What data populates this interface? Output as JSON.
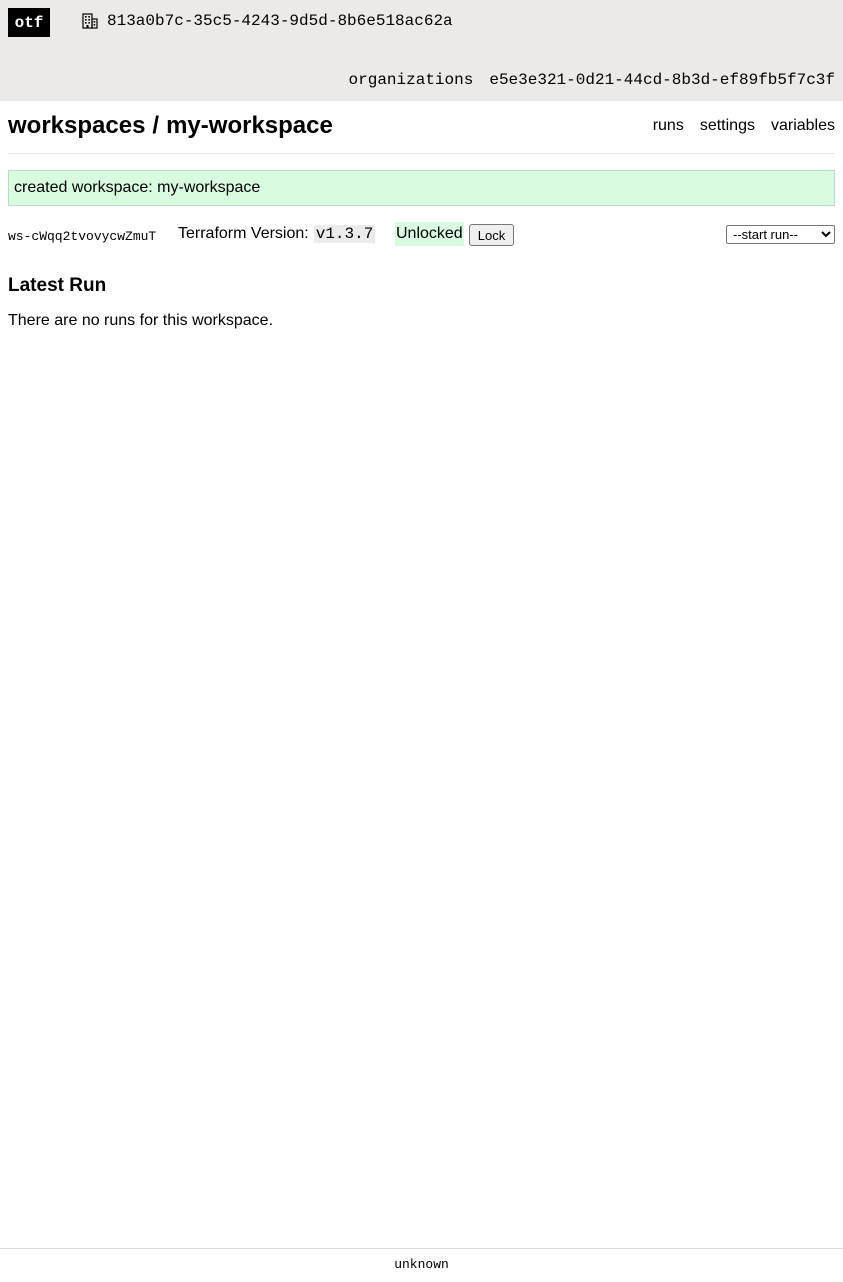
{
  "header": {
    "logo": "otf",
    "current_organization": {
      "icon": "building-icon",
      "name": "813a0b7c-35c5-4243-9d5d-8b6e518ac62a"
    },
    "nav": {
      "organizations_label": "organizations",
      "organization_link": "e5e3e321-0d21-44cd-8b3d-ef89fb5f7c3f"
    }
  },
  "page": {
    "breadcrumb": {
      "parent": "workspaces",
      "separator": "/",
      "current": "my-workspace"
    },
    "tabs": [
      {
        "label": "runs"
      },
      {
        "label": "settings"
      },
      {
        "label": "variables"
      }
    ]
  },
  "flash": {
    "message": "created workspace: my-workspace",
    "color": "#d9fbe0"
  },
  "workspace": {
    "id": "ws-cWqq2tvovycwZmuT",
    "terraform_version_label": "Terraform Version:",
    "terraform_version": "v1.3.7",
    "lock_status": "Unlocked",
    "lock_button_label": "Lock",
    "start_run_selected": "--start run--"
  },
  "latest_run": {
    "heading": "Latest Run",
    "empty_message": "There are no runs for this workspace."
  },
  "footer": {
    "version": "unknown"
  }
}
